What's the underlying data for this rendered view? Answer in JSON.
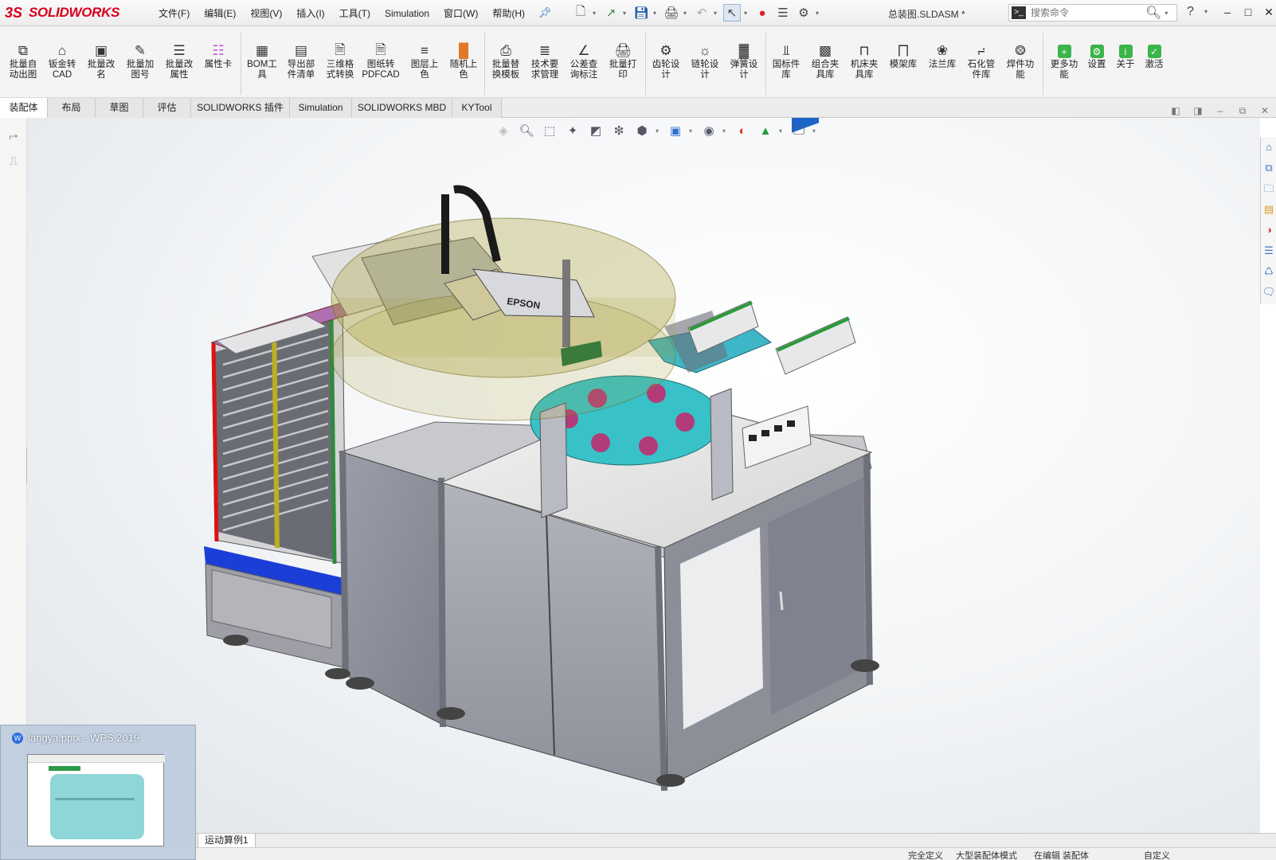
{
  "app": {
    "brand": "SOLIDWORKS",
    "ds_mark": "3S",
    "doc_title": "总装图.SLDASM *"
  },
  "menu": [
    "文件(F)",
    "编辑(E)",
    "视图(V)",
    "插入(I)",
    "工具(T)",
    "Simulation",
    "窗口(W)",
    "帮助(H)"
  ],
  "search": {
    "placeholder": "搜索命令"
  },
  "ribbon": [
    {
      "l1": "批量自",
      "l2": "动出图",
      "icon": "copy-icon"
    },
    {
      "l1": "钣金转",
      "l2": "CAD",
      "icon": "sheetmetal-icon"
    },
    {
      "l1": "批量改",
      "l2": "名",
      "icon": "rename-icon"
    },
    {
      "l1": "批量加",
      "l2": "图号",
      "icon": "edit-icon"
    },
    {
      "l1": "批量改",
      "l2": "属性",
      "icon": "list-icon"
    },
    {
      "l1": "属性卡",
      "l2": "",
      "icon": "property-card-icon"
    },
    {
      "l1": "BOM工",
      "l2": "具",
      "icon": "bom-icon"
    },
    {
      "l1": "导出部",
      "l2": "件清单",
      "icon": "export-list-icon"
    },
    {
      "l1": "三维格",
      "l2": "式转换",
      "icon": "pdf-icon"
    },
    {
      "l1": "图纸转",
      "l2": "PDFCAD",
      "icon": "pdf-convert-icon"
    },
    {
      "l1": "图层上",
      "l2": "色",
      "icon": "layers-icon"
    },
    {
      "l1": "随机上",
      "l2": "色",
      "icon": "color-bars-icon"
    },
    {
      "l1": "批量替",
      "l2": "换模板",
      "icon": "template-icon"
    },
    {
      "l1": "技术要",
      "l2": "求管理",
      "icon": "text-icon"
    },
    {
      "l1": "公差查",
      "l2": "询标注",
      "icon": "tolerance-icon"
    },
    {
      "l1": "批量打",
      "l2": "印",
      "icon": "printer-icon"
    },
    {
      "l1": "齿轮设",
      "l2": "计",
      "icon": "gear-icon"
    },
    {
      "l1": "链轮设",
      "l2": "计",
      "icon": "chain-icon"
    },
    {
      "l1": "弹簧设",
      "l2": "计",
      "icon": "spring-icon"
    },
    {
      "l1": "国标件",
      "l2": "库",
      "icon": "bolt-icon"
    },
    {
      "l1": "组合夹",
      "l2": "具库",
      "icon": "fixture-icon"
    },
    {
      "l1": "机床夹",
      "l2": "具库",
      "icon": "clamp-icon"
    },
    {
      "l1": "模架库",
      "l2": "",
      "icon": "mold-icon"
    },
    {
      "l1": "法兰库",
      "l2": "",
      "icon": "flange-icon"
    },
    {
      "l1": "石化管",
      "l2": "件库",
      "icon": "pipe-icon"
    },
    {
      "l1": "焊件功",
      "l2": "能",
      "icon": "weld-icon"
    },
    {
      "l1": "更多功",
      "l2": "能",
      "icon": "plus-icon"
    },
    {
      "l1": "设置",
      "l2": "",
      "icon": "settings-icon"
    },
    {
      "l1": "关于",
      "l2": "",
      "icon": "info-icon"
    },
    {
      "l1": "激活",
      "l2": "",
      "icon": "activate-icon"
    }
  ],
  "tabs": [
    "装配体",
    "布局",
    "草图",
    "评估",
    "SOLIDWORKS 插件",
    "Simulation",
    "SOLIDWORKS MBD",
    "KYTool"
  ],
  "model": {
    "robot_label": "EPSON"
  },
  "motion_tab": "运动算例1",
  "status": [
    "完全定义",
    "大型装配体模式",
    "在编辑 装配体",
    "自定义"
  ],
  "thumbnail": {
    "title": "langya.pptx - WPS 2019",
    "app_badge": "W"
  },
  "colors": {
    "brand_red": "#d6001c",
    "accent_blue": "#2a6cc0",
    "viewport_bg": "#eef1f4"
  }
}
